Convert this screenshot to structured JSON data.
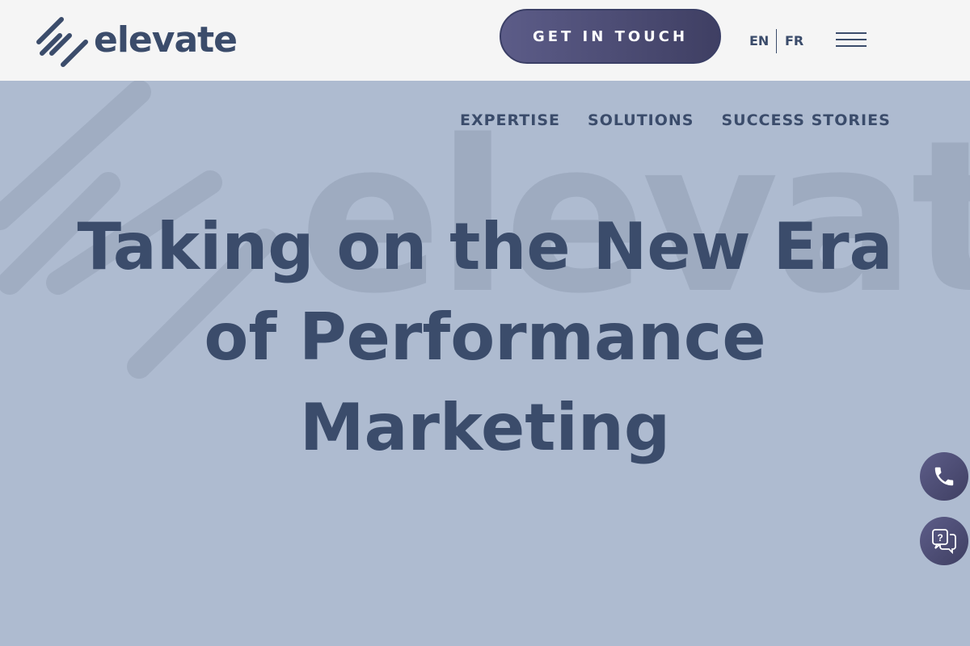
{
  "brand": {
    "name": "elevate",
    "logo_icon": "stripes-icon"
  },
  "header": {
    "cta_label": "GET IN TOUCH",
    "languages": [
      "EN",
      "FR"
    ],
    "menu_icon": "hamburger-icon"
  },
  "nav": {
    "items": [
      {
        "label": "EXPERTISE"
      },
      {
        "label": "SOLUTIONS"
      },
      {
        "label": "SUCCESS STORIES"
      }
    ]
  },
  "hero": {
    "background_word": "elevate",
    "headline_lines": [
      "Taking on the New Era",
      "of Performance",
      "Marketing"
    ]
  },
  "floating_actions": [
    {
      "icon": "phone-icon"
    },
    {
      "icon": "help-chat-icon"
    }
  ],
  "colors": {
    "header_bg": "#f5f5f5",
    "hero_bg": "#aebbd0",
    "text_dark": "#3b4c6b",
    "button_gradient_start": "#5c5c88",
    "button_gradient_end": "#3f3f63"
  }
}
